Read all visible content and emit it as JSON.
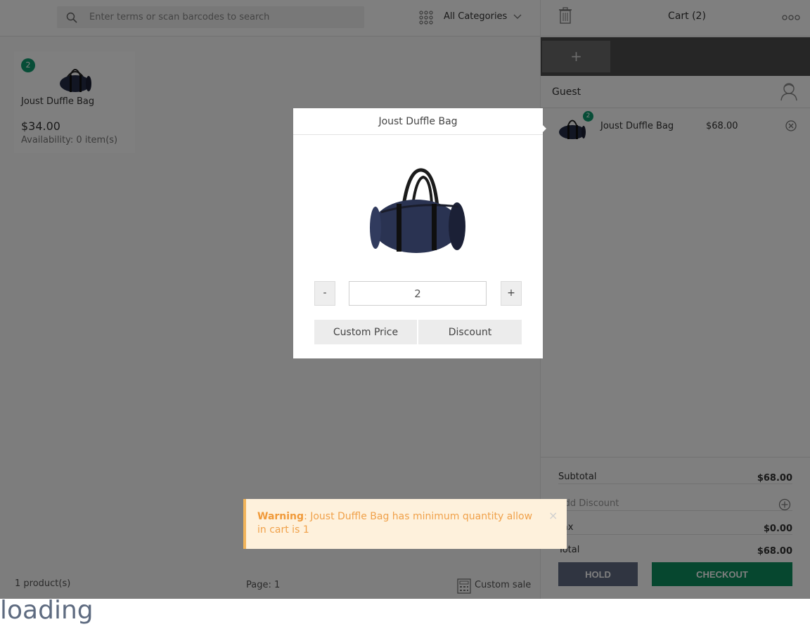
{
  "search": {
    "placeholder": "Enter terms or scan barcodes to search"
  },
  "categories": {
    "selected": "All Categories"
  },
  "product": {
    "badge": "2",
    "name": "Joust Duffle Bag",
    "price": "$34.00",
    "availability": "Availability: 0 item(s)"
  },
  "footer": {
    "product_count": "1 product(s)",
    "page": "Page: 1",
    "custom_sale": "Custom sale"
  },
  "cart": {
    "title": "Cart (2)",
    "add_tab": "+",
    "customer": "Guest",
    "item": {
      "qty": "2",
      "name": "Joust Duffle Bag",
      "price": "$68.00"
    },
    "totals": {
      "subtotal_label": "Subtotal",
      "subtotal_value": "$68.00",
      "add_discount_label": "Add Discount",
      "tax_label": "Tax",
      "tax_value": "$0.00",
      "total_label": "Total",
      "total_value": "$68.00"
    },
    "hold_label": "HOLD",
    "checkout_label": "CHECKOUT"
  },
  "modal": {
    "title": "Joust Duffle Bag",
    "qty_minus": "-",
    "qty_value": "2",
    "qty_plus": "+",
    "custom_price_label": "Custom Price",
    "discount_label": "Discount"
  },
  "toast": {
    "title": "Warning",
    "message": ": Joust Duffle Bag has minimum quantity allow in cart is 1",
    "close": "×"
  },
  "loading": "loading"
}
